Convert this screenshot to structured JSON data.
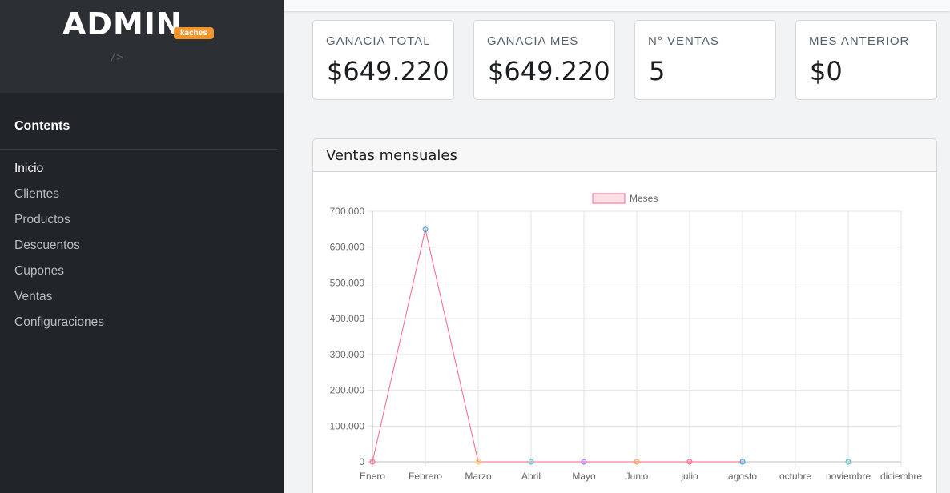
{
  "brand": {
    "title": "ADMIN",
    "badge": "kaches",
    "subtitle": "/>"
  },
  "sidebar": {
    "heading": "Contents",
    "items": [
      {
        "label": "Inicio"
      },
      {
        "label": "Clientes"
      },
      {
        "label": "Productos"
      },
      {
        "label": "Descuentos"
      },
      {
        "label": "Cupones"
      },
      {
        "label": "Ventas"
      },
      {
        "label": "Configuraciones"
      }
    ]
  },
  "stats": [
    {
      "label": "GANACIA TOTAL",
      "value": "$649.220"
    },
    {
      "label": "GANACIA MES",
      "value": "$649.220"
    },
    {
      "label": "N° VENTAS",
      "value": "5"
    },
    {
      "label": "MES ANTERIOR",
      "value": "$0"
    }
  ],
  "chart_card": {
    "title": "Ventas mensuales"
  },
  "colors": {
    "line": "#ff6384",
    "sidebar": "#212429",
    "badge": "#f0952e"
  },
  "chart_data": {
    "type": "line",
    "categories": [
      "Enero",
      "Febrero",
      "Marzo",
      "Abril",
      "Mayo",
      "Junio",
      "julio",
      "agosto",
      "octubre",
      "noviembre",
      "diciembre"
    ],
    "series": [
      {
        "name": "Meses",
        "values": [
          0,
          649220,
          0,
          0,
          0,
          0,
          0,
          0,
          null,
          0,
          null
        ],
        "point_colors": [
          "#ff6384",
          "#36a2eb",
          "#ffce56",
          "#4bc0c0",
          "#9966ff",
          "#ff9f40",
          "#ff6384",
          "#36a2eb",
          null,
          "#4bc0c0",
          null
        ]
      }
    ],
    "yticks": [
      "0",
      "100.000",
      "200.000",
      "300.000",
      "400.000",
      "500.000",
      "600.000",
      "700.000"
    ],
    "ylim": [
      0,
      700000
    ],
    "grid": true,
    "legend": "top-center"
  }
}
